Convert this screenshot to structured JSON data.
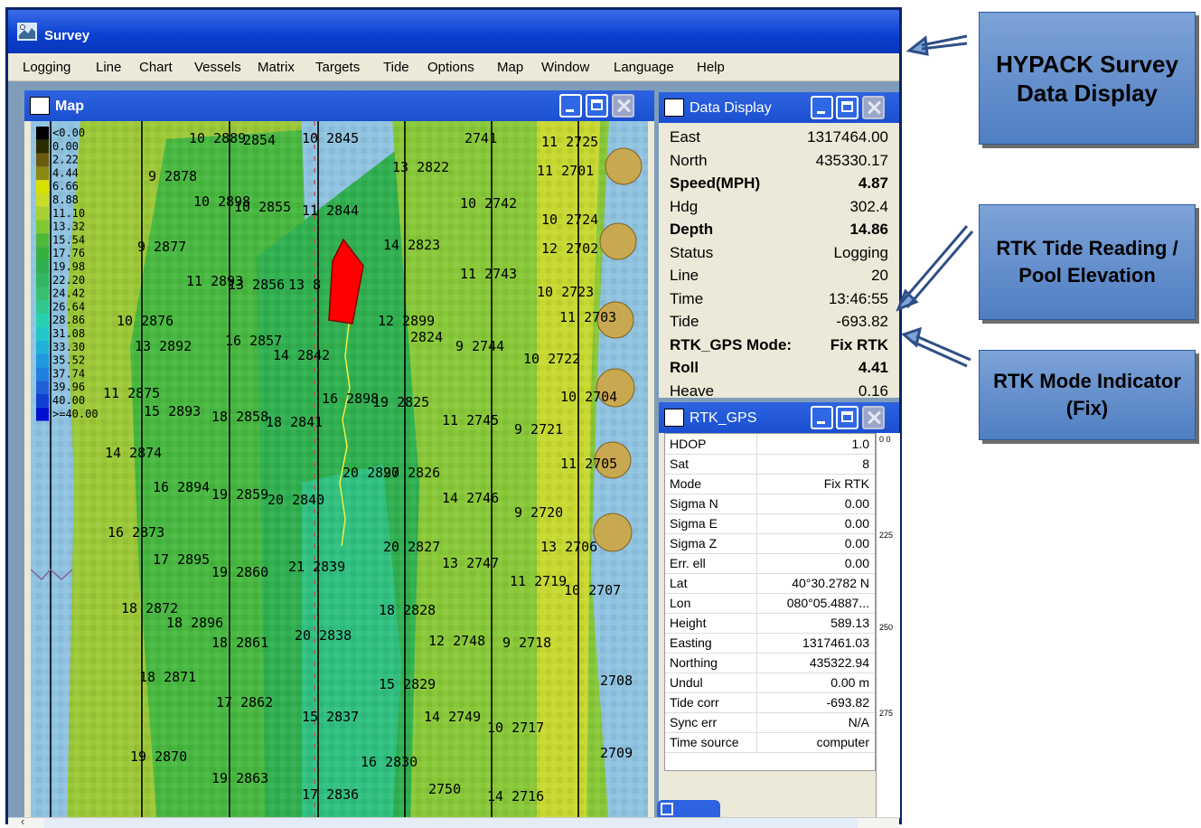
{
  "app": {
    "title": "Survey",
    "menu": [
      "Logging",
      "Line",
      "Chart",
      "Vessels",
      "Matrix",
      "Targets",
      "Tide",
      "Options",
      "Map",
      "Window",
      "Language",
      "Help"
    ]
  },
  "map_window": {
    "title": "Map",
    "legend": [
      "<0.00",
      "0.00",
      "2.22",
      "4.44",
      "6.66",
      "8.88",
      "11.10",
      "13.32",
      "15.54",
      "17.76",
      "19.98",
      "22.20",
      "24.42",
      "26.64",
      "28.86",
      "31.08",
      "33.30",
      "35.52",
      "37.74",
      "39.96",
      "40.00",
      ">=40.00"
    ],
    "legend_colors": [
      "#000000",
      "#2b2b00",
      "#6b5a10",
      "#8a8a10",
      "#d8e000",
      "#c8dc28",
      "#a8d030",
      "#80c830",
      "#50b838",
      "#38b040",
      "#30b050",
      "#30b860",
      "#38c070",
      "#30c890",
      "#28d0b0",
      "#20c8c8",
      "#20b0d8",
      "#2098e0",
      "#2080e0",
      "#2060d8",
      "#1040d0",
      "#0010d0"
    ],
    "labels": [
      {
        "t": "10",
        "t2": "2889"
      },
      {
        "t": "2854"
      },
      {
        "t": "10",
        "t2": "2845"
      },
      {
        "t": "2741"
      },
      {
        "t": "11",
        "t2": "2725"
      },
      {
        "t": "9",
        "t2": "2878"
      },
      {
        "t": "13",
        "t2": "2822"
      },
      {
        "t": "11",
        "t2": "2701"
      },
      {
        "t": "10",
        "t2": "2898"
      },
      {
        "t": "10",
        "t2": "2855"
      },
      {
        "t": "11",
        "t2": "2844"
      },
      {
        "t": "10",
        "t2": "2742"
      },
      {
        "t": "10",
        "t2": "2724"
      },
      {
        "t": "9",
        "t2": "2877"
      },
      {
        "t": "14",
        "t2": "2823"
      },
      {
        "t": "12",
        "t2": "2702"
      },
      {
        "t": "11",
        "t2": "2893"
      },
      {
        "t": "13",
        "t2": "2856"
      },
      {
        "t": "13",
        "t2": "8"
      },
      {
        "t": "11",
        "t2": "2743"
      },
      {
        "t": "10",
        "t2": "2723"
      },
      {
        "t": "10",
        "t2": "2876"
      },
      {
        "t": "12",
        "t2": "2899"
      },
      {
        "t": "2824"
      },
      {
        "t": "11",
        "t2": "2703"
      },
      {
        "t": "13",
        "t2": "2892"
      },
      {
        "t": "16",
        "t2": "2857"
      },
      {
        "t": "14",
        "t2": "2842"
      },
      {
        "t": "9",
        "t2": "2744"
      },
      {
        "t": "10",
        "t2": "2722"
      },
      {
        "t": "11",
        "t2": "2875"
      },
      {
        "t": "16",
        "t2": "2898"
      },
      {
        "t": "19",
        "t2": "2825"
      },
      {
        "t": "10",
        "t2": "2704"
      },
      {
        "t": "15",
        "t2": "2893"
      },
      {
        "t": "18",
        "t2": "2858"
      },
      {
        "t": "18",
        "t2": "2841"
      },
      {
        "t": "11",
        "t2": "2745"
      },
      {
        "t": "9",
        "t2": "2721"
      },
      {
        "t": "14",
        "t2": "2874"
      },
      {
        "t": "20",
        "t2": "2897"
      },
      {
        "t": "20",
        "t2": "2826"
      },
      {
        "t": "11",
        "t2": "2705"
      },
      {
        "t": "16",
        "t2": "2894"
      },
      {
        "t": "19",
        "t2": "2859"
      },
      {
        "t": "20",
        "t2": "2840"
      },
      {
        "t": "14",
        "t2": "2746"
      },
      {
        "t": "9",
        "t2": "2720"
      },
      {
        "t": "16",
        "t2": "2873"
      },
      {
        "t": "20",
        "t2": "2827"
      },
      {
        "t": "13",
        "t2": "2706"
      },
      {
        "t": "17",
        "t2": "2895"
      },
      {
        "t": "19",
        "t2": "2860"
      },
      {
        "t": "21",
        "t2": "2839"
      },
      {
        "t": "13",
        "t2": "2747"
      },
      {
        "t": "11",
        "t2": "2719"
      },
      {
        "t": "18",
        "t2": "2872"
      },
      {
        "t": "18",
        "t2": "2828"
      },
      {
        "t": "10",
        "t2": "2707"
      },
      {
        "t": "18",
        "t2": "2896"
      },
      {
        "t": "18",
        "t2": "2861"
      },
      {
        "t": "20",
        "t2": "2838"
      },
      {
        "t": "12",
        "t2": "2748"
      },
      {
        "t": "9",
        "t2": "2718"
      },
      {
        "t": "18",
        "t2": "2871"
      },
      {
        "t": "15",
        "t2": "2829"
      },
      {
        "t": "2708"
      },
      {
        "t": "17",
        "t2": "2862"
      },
      {
        "t": "15",
        "t2": "2837"
      },
      {
        "t": "14",
        "t2": "2749"
      },
      {
        "t": "10",
        "t2": "2717"
      },
      {
        "t": "19",
        "t2": "2870"
      },
      {
        "t": "16",
        "t2": "2830"
      },
      {
        "t": "2709"
      },
      {
        "t": "19",
        "t2": "2863"
      },
      {
        "t": "17",
        "t2": "2836"
      },
      {
        "t": "2750"
      },
      {
        "t": "14",
        "t2": "2716"
      }
    ]
  },
  "data_display": {
    "title": "Data Display",
    "rows": [
      {
        "label": "East",
        "value": "1317464.00",
        "bold": false
      },
      {
        "label": "North",
        "value": "435330.17",
        "bold": false
      },
      {
        "label": "Speed(MPH)",
        "value": "4.87",
        "bold": true
      },
      {
        "label": "Hdg",
        "value": "302.4",
        "bold": false
      },
      {
        "label": "Depth",
        "value": "14.86",
        "bold": true
      },
      {
        "label": "Status",
        "value": "Logging",
        "bold": false
      },
      {
        "label": "Line",
        "value": "20",
        "bold": false
      },
      {
        "label": "Time",
        "value": "13:46:55",
        "bold": false
      },
      {
        "label": "Tide",
        "value": "-693.82",
        "bold": false
      },
      {
        "label": "RTK_GPS Mode:",
        "value": "Fix RTK",
        "bold": true
      },
      {
        "label": "Roll",
        "value": "4.41",
        "bold": true
      },
      {
        "label": "Heave",
        "value": "0.16",
        "bold": false
      }
    ]
  },
  "rtk_gps": {
    "title": "RTK_GPS",
    "rows": [
      {
        "label": "HDOP",
        "value": "1.0"
      },
      {
        "label": "Sat",
        "value": "8"
      },
      {
        "label": "Mode",
        "value": "Fix RTK"
      },
      {
        "label": "Sigma N",
        "value": "0.00"
      },
      {
        "label": "Sigma E",
        "value": "0.00"
      },
      {
        "label": "Sigma Z",
        "value": "0.00"
      },
      {
        "label": "Err. ell",
        "value": "0.00"
      },
      {
        "label": "Lat",
        "value": "40°30.2782 N"
      },
      {
        "label": "Lon",
        "value": "080°05.4887..."
      },
      {
        "label": "Height",
        "value": "589.13"
      },
      {
        "label": "Easting",
        "value": "1317461.03"
      },
      {
        "label": "Northing",
        "value": "435322.94"
      },
      {
        "label": "Undul",
        "value": "0.00 m"
      },
      {
        "label": "Tide corr",
        "value": "-693.82"
      },
      {
        "label": "Sync err",
        "value": "N/A"
      },
      {
        "label": "Time source",
        "value": "computer"
      }
    ],
    "side_ticks": [
      "0 0",
      "225",
      "250",
      "275"
    ]
  },
  "callouts": {
    "survey": "HYPACK Survey Data Display",
    "tide": "RTK Tide Reading / Pool Elevation",
    "mode": "RTK Mode Indicator (Fix)"
  },
  "colors": {
    "titlebar": "#0a3fd0",
    "callout": "#6a92cf",
    "water": "#8fc3e0",
    "vessel": "#ff0000"
  }
}
